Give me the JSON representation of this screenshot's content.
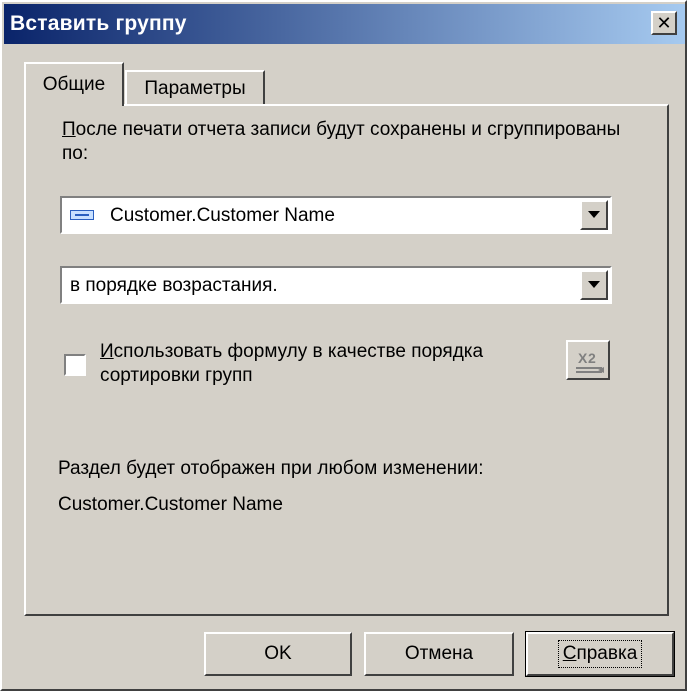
{
  "window": {
    "title": "Вставить группу",
    "close_glyph": "✕"
  },
  "tabs": [
    {
      "label": "Общие",
      "active": true
    },
    {
      "label": "Параметры",
      "active": false
    }
  ],
  "general": {
    "description_first_letter": "П",
    "description_rest": "осле печати отчета записи будут сохранены и сгруппированы по:",
    "group_field": {
      "value": "Customer.Customer Name",
      "icon": "database-field-icon"
    },
    "sort_order": {
      "value": "в порядке возрастания."
    },
    "use_formula": {
      "checked": false,
      "label_first_letter": "И",
      "label_rest": "спользовать формулу в качестве порядка сортировки групп"
    },
    "formula_button_icon": "formula-editor-icon",
    "section_info_label": "Раздел будет отображен при любом изменении:",
    "section_info_value": "Customer.Customer Name"
  },
  "buttons": {
    "ok": "OK",
    "cancel": "Отмена",
    "help_first_letter": "С",
    "help_rest": "правка"
  }
}
